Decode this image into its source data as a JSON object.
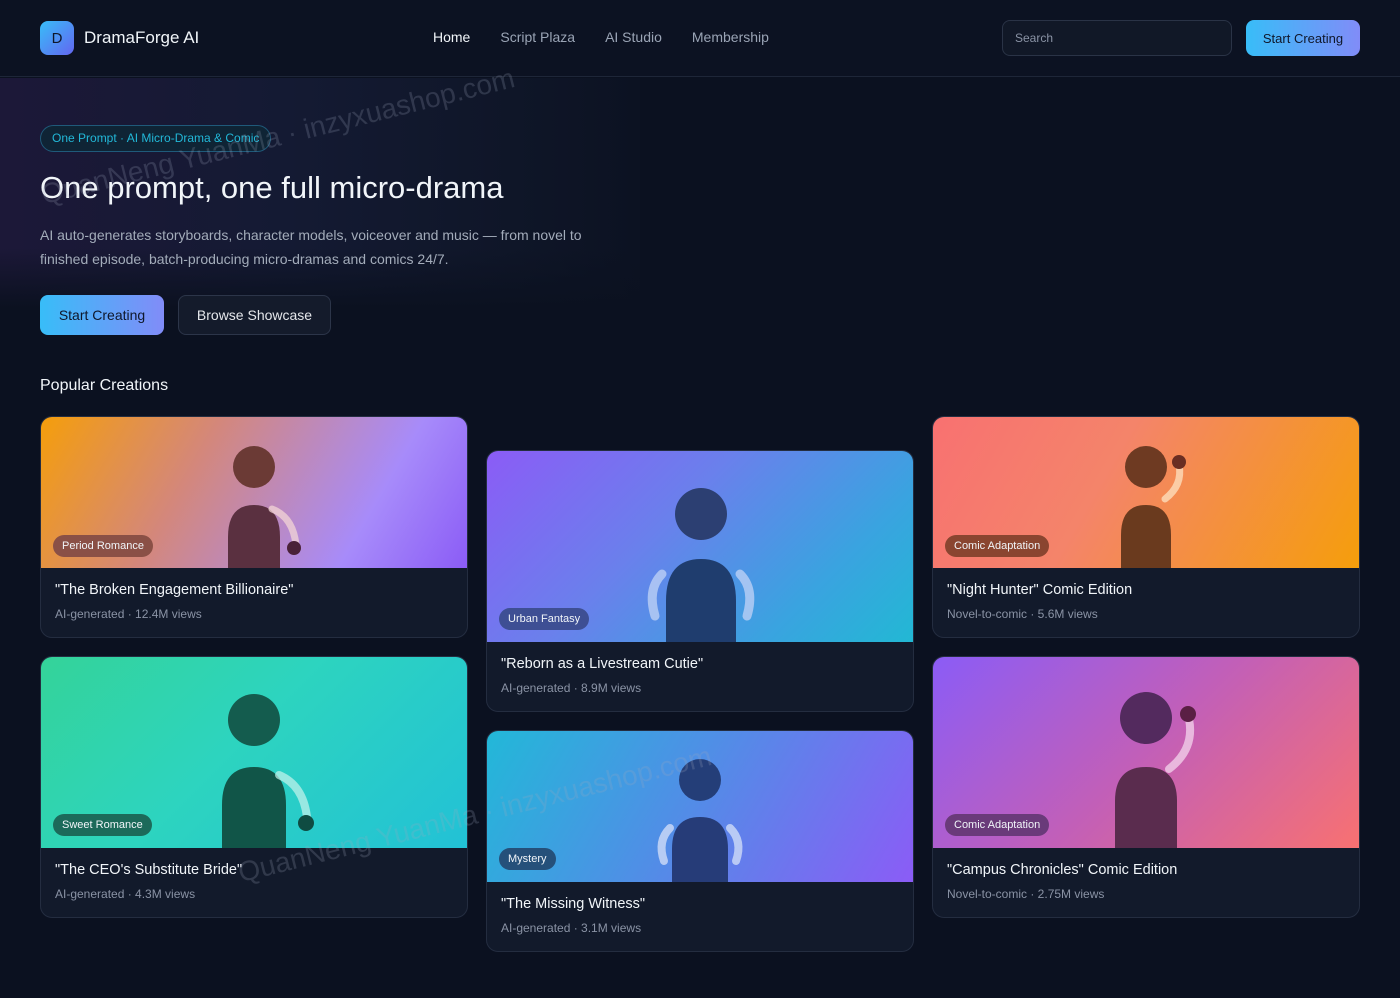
{
  "brand": {
    "logo_letter": "D",
    "name": "DramaForge AI"
  },
  "nav": {
    "items": [
      "Home",
      "Script Plaza",
      "AI Studio",
      "Membership"
    ],
    "active_index": 0
  },
  "search": {
    "placeholder": "Search"
  },
  "header_cta": "Start Creating",
  "hero": {
    "pill": "One Prompt · AI Micro-Drama & Comic",
    "title": "One prompt, one full micro-drama",
    "description": "AI auto-generates storyboards, character models, voiceover and music — from novel to finished episode, batch-producing micro-dramas and comics 24/7.",
    "primary_button": "Start Creating",
    "secondary_button": "Browse Showcase"
  },
  "section_title": "Popular Creations",
  "cards": [
    {
      "tag": "Period Romance",
      "title": "\"The Broken Engagement Billionaire\"",
      "meta": "AI-generated · 12.4M views",
      "tag_color": "#8a5046"
    },
    {
      "tag": "Urban Fantasy",
      "title": "\"Reborn as a Livestream Cutie\"",
      "meta": "AI-generated · 8.9M views",
      "tag_color": "#3e4f94"
    },
    {
      "tag": "Comic Adaptation",
      "title": "\"Night Hunter\" Comic Edition",
      "meta": "Novel-to-comic · 5.6M views",
      "tag_color": "#8a4530"
    },
    {
      "tag": "Sweet Romance",
      "title": "\"The CEO's Substitute Bride\"",
      "meta": "AI-generated · 4.3M views",
      "tag_color": "#1c6a5a"
    },
    {
      "tag": "Mystery",
      "title": "\"The Missing Witness\"",
      "meta": "AI-generated · 3.1M views",
      "tag_color": "#25507a"
    },
    {
      "tag": "Comic Adaptation",
      "title": "\"Campus Chronicles\" Comic Edition",
      "meta": "Novel-to-comic · 2.75M views",
      "tag_color": "#6a3a7a"
    }
  ],
  "watermark": "QuanNeng YuanMa · inzyxuashop.com"
}
